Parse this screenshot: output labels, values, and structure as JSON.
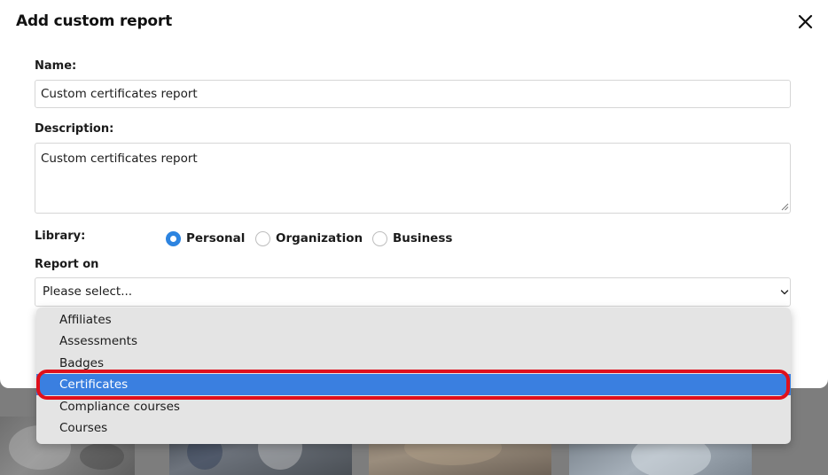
{
  "modal": {
    "title": "Add custom report",
    "close_icon": "close-icon"
  },
  "form": {
    "name": {
      "label": "Name:",
      "value": "Custom certificates report"
    },
    "description": {
      "label": "Description:",
      "value": "Custom certificates report"
    },
    "library": {
      "label": "Library:",
      "options": [
        {
          "label": "Personal",
          "checked": true
        },
        {
          "label": "Organization",
          "checked": false
        },
        {
          "label": "Business",
          "checked": false
        }
      ]
    },
    "report_on": {
      "label": "Report on",
      "placeholder": "Please select...",
      "chevron_icon": "chevron-down-icon",
      "options": [
        {
          "label": "Affiliates",
          "selected": false
        },
        {
          "label": "Assessments",
          "selected": false
        },
        {
          "label": "Badges",
          "selected": false
        },
        {
          "label": "Certificates",
          "selected": true
        },
        {
          "label": "Compliance courses",
          "selected": false
        },
        {
          "label": "Courses",
          "selected": false
        }
      ]
    }
  },
  "colors": {
    "accent_blue": "#2d84e0",
    "selected_row": "#3a7fe0",
    "highlight_red": "#e0101b",
    "background_button_green": "#22c79a"
  }
}
